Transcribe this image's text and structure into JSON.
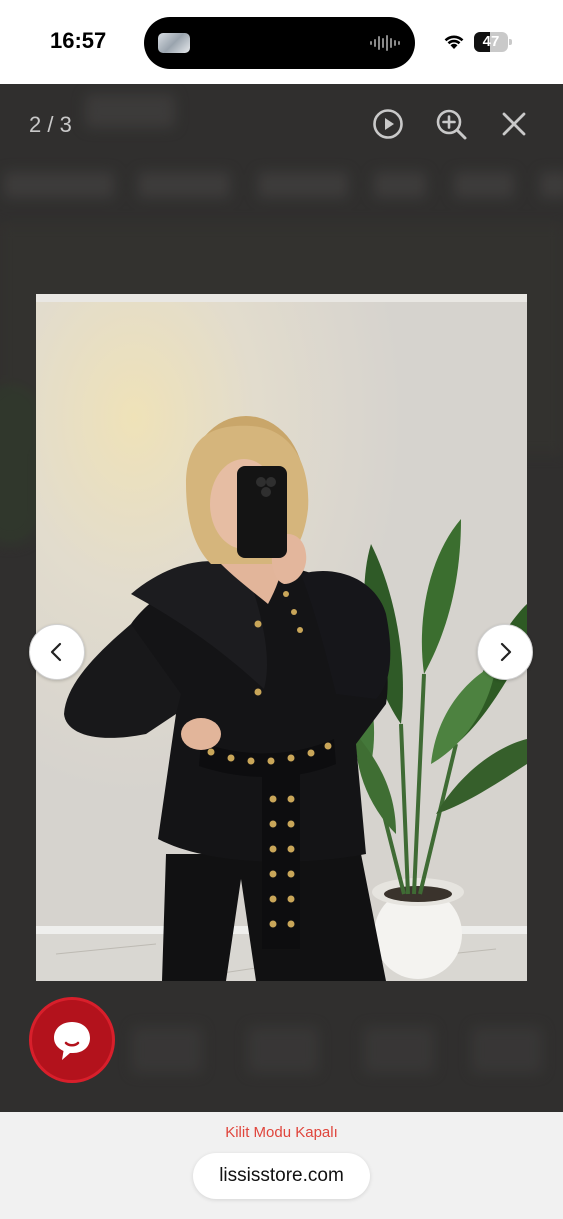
{
  "status_bar": {
    "time": "16:57",
    "battery_level": "47",
    "battery_fraction": 0.47
  },
  "viewer": {
    "counter": "2 / 3",
    "icons": [
      "play-icon",
      "zoom-in-icon",
      "close-icon",
      "chevron-left-icon",
      "chevron-right-icon"
    ]
  },
  "chat": {
    "icon": "chat-bubble-icon",
    "color": "#b3121c"
  },
  "browser": {
    "lock_mode_text": "Kilit Modu Kapalı",
    "url": "lississtore.com",
    "lock_mode_color": "#e0453c"
  }
}
